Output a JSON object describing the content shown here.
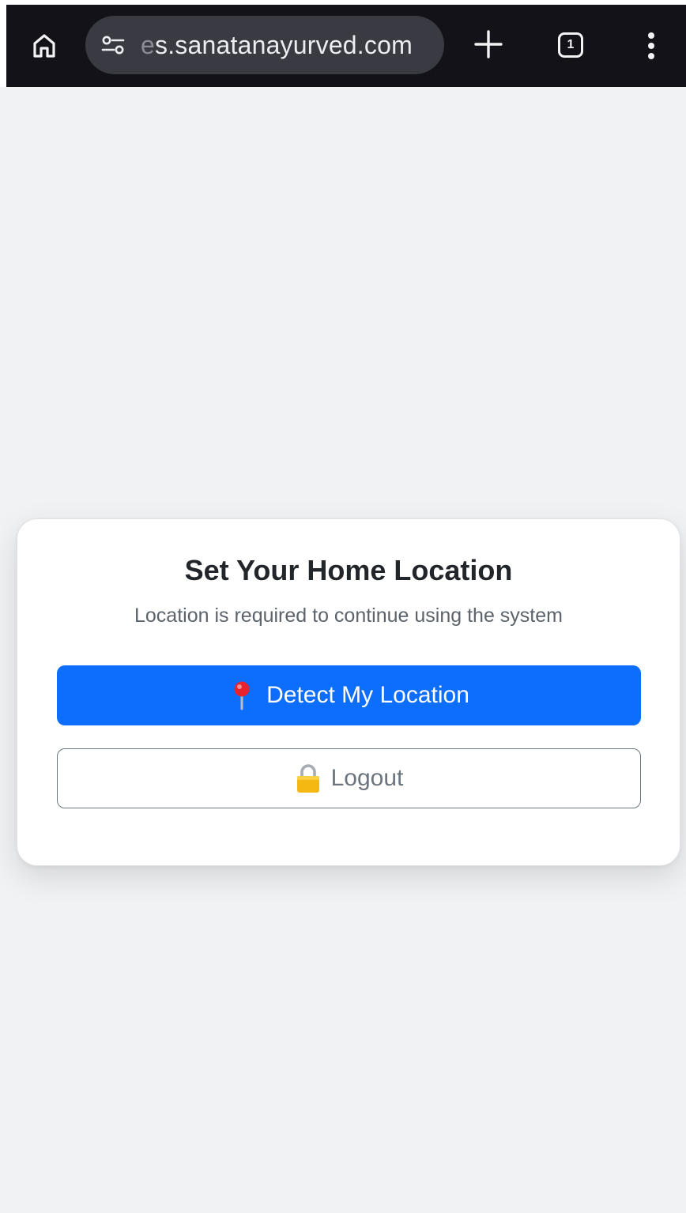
{
  "browser": {
    "url_prefix_faded": "e",
    "url_text": "s.sanatanayurved.com",
    "tab_count": "1",
    "icons": {
      "home": "home-icon",
      "site_settings": "site-settings-icon",
      "new_tab": "plus-icon",
      "tabs": "tab-switcher-icon",
      "menu": "more-vert-icon"
    }
  },
  "modal": {
    "title": "Set Your Home Location",
    "subtitle": "Location is required to continue using the system",
    "detect_button": {
      "label": "Detect My Location",
      "icon": "map-pin-icon",
      "color": "#0d6efd"
    },
    "logout_button": {
      "label": "Logout",
      "icon": "lock-icon",
      "color": "#6c757d"
    }
  },
  "colors": {
    "page_background": "#f1f2f4",
    "toolbar_background": "#121218",
    "url_pill": "#3a3a42"
  }
}
